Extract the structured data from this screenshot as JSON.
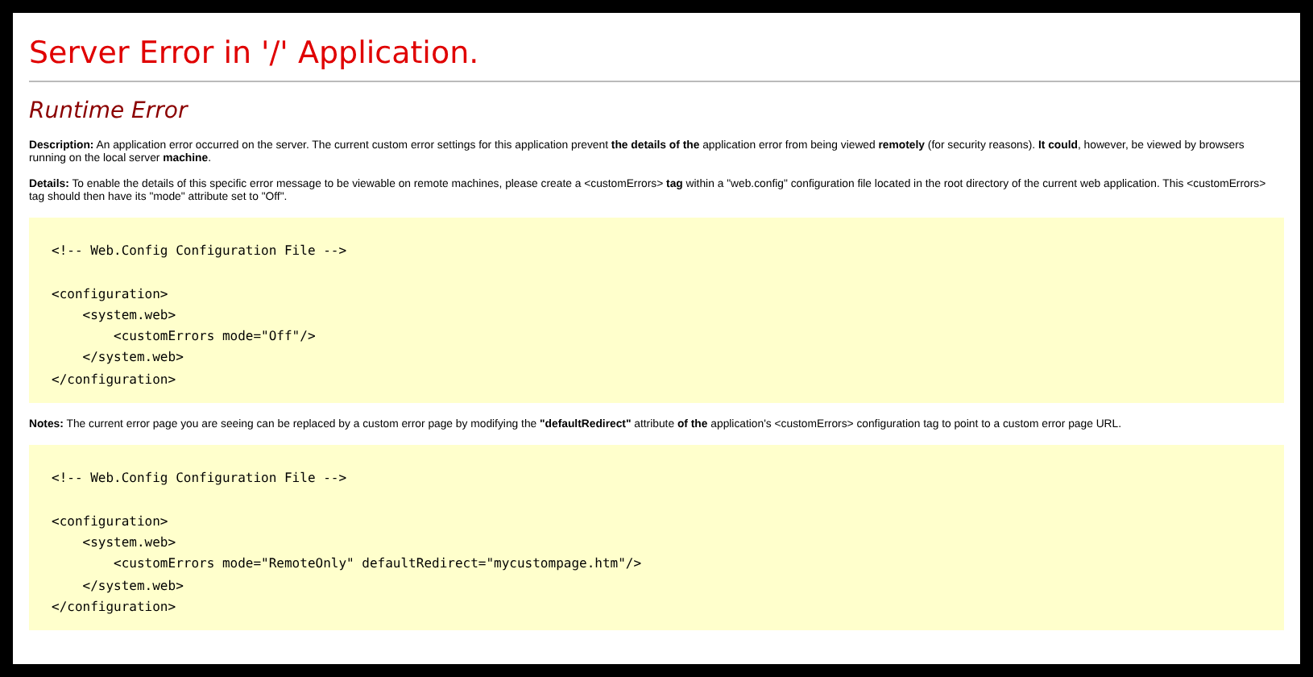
{
  "title": "Server Error in '/' Application.",
  "subtitle": "Runtime Error",
  "sections": [
    {
      "kind": "paragraph",
      "label": "Description:",
      "text": "An application error occurred on the server. The current custom error settings for this application prevent **the details of the** application error from being viewed **remotely** (for security reasons). **It could**, however, be viewed by browsers running on the local server **machine**."
    },
    {
      "kind": "paragraph",
      "label": "Details:",
      "text": "To enable the details of this specific error message to be viewable on remote machines, please create a <customErrors> **tag** within a \"web.config\" configuration file located in the root directory of the current web application. This <customErrors> tag should then have its \"mode\" attribute set to \"Off\"."
    },
    {
      "kind": "code",
      "comment": "<!-- Web.Config Configuration File -->",
      "lines": [
        "<configuration>",
        "    <system.web>",
        "        <customErrors mode=\"Off\"/>",
        "    </system.web>",
        "</configuration>"
      ]
    },
    {
      "kind": "paragraph",
      "label": "Notes:",
      "text": "The current error page you are seeing can be replaced by a custom error page by modifying the **\"defaultRedirect\"** attribute **of the** application's <customErrors> configuration tag to point to a custom error page URL."
    },
    {
      "kind": "code",
      "comment": "<!-- Web.Config Configuration File -->",
      "lines": [
        "<configuration>",
        "    <system.web>",
        "        <customErrors mode=\"RemoteOnly\" defaultRedirect=\"mycustompage.htm\"/>",
        "    </system.web>",
        "</configuration>"
      ]
    }
  ]
}
